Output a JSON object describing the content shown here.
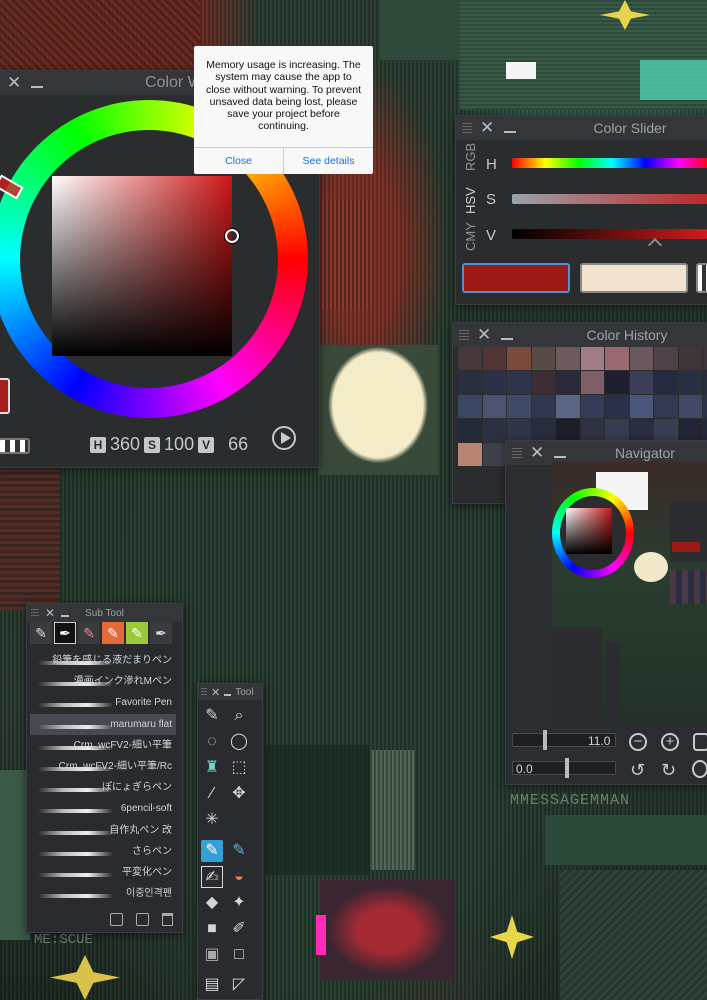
{
  "dialog": {
    "message": "Memory usage is increasing. The system may cause the app to close without warning. To prevent unsaved data being lost, please save your project before continuing.",
    "close_label": "Close",
    "details_label": "See details"
  },
  "color_wheel": {
    "title": "Color Wheel",
    "h_tag": "H",
    "h_value": "360",
    "s_tag": "S",
    "s_value": "100",
    "v_tag": "V",
    "v_value": "66",
    "current_color": "#a51c1c"
  },
  "color_slider": {
    "title": "Color Slider",
    "tabs": [
      "RGB",
      "HSV",
      "CMY"
    ],
    "h_label": "H",
    "s_label": "S",
    "v_label": "V",
    "main_color": "#9c1a16",
    "sub_color": "#f1e3d0"
  },
  "color_history": {
    "title": "Color History",
    "swatches": [
      "#46383a",
      "#553533",
      "#7a4a3a",
      "#5a4a46",
      "#6c5a5c",
      "#a27c86",
      "#9a6a72",
      "#6e5860",
      "#4c4248",
      "#40363a",
      "#3a3438",
      "#2a2f40",
      "#2c3148",
      "#30344a",
      "#3d2e36",
      "#2a2a3a",
      "#7e5f66",
      "#1e2030",
      "#3a3e58",
      "#262a40",
      "#283044",
      "#2a2e3c",
      "#3a4662",
      "#4a5472",
      "#3e4a66",
      "#2e3650",
      "#5a6684",
      "#343c58",
      "#2a3048",
      "#4a567a",
      "#323a52",
      "#404a66",
      "#2e3448",
      "#262a38",
      "#2c3040",
      "#30364a",
      "#282c3c",
      "#1c1e2a",
      "#2e3242",
      "#363c52",
      "#2a2e40",
      "#383e54",
      "#222634",
      "#242838",
      "#b88472",
      "#40404c",
      "#2e3040",
      "#282a36",
      "#323444",
      "#2a2c38",
      "#303242",
      "#262836",
      "#343648",
      "#2c2e3e",
      "#282a38"
    ]
  },
  "navigator": {
    "title": "Navigator",
    "zoom_value": "11.0",
    "rotation_value": "0.0"
  },
  "sub_tool": {
    "title": "Sub Tool",
    "brushes": [
      "鉛筆を感じる液だまりペン",
      "漫画インク滲れMペン",
      "Favorite Pen",
      "marumaru flat",
      "Crm_wcFV2-細い平筆",
      "Crm_wcFV2-細い平筆/Rc",
      "ぽにょぎらペン",
      "6pencil-soft",
      "自作丸ペン 改",
      "さらペン",
      "平変化ペン",
      "이중인격펜"
    ],
    "selected_index": 3
  },
  "tool": {
    "title": "Tool"
  },
  "canvas": {
    "sign_text": "MMESSAGEMMAN",
    "stamp_text": "ME:SCUE"
  }
}
